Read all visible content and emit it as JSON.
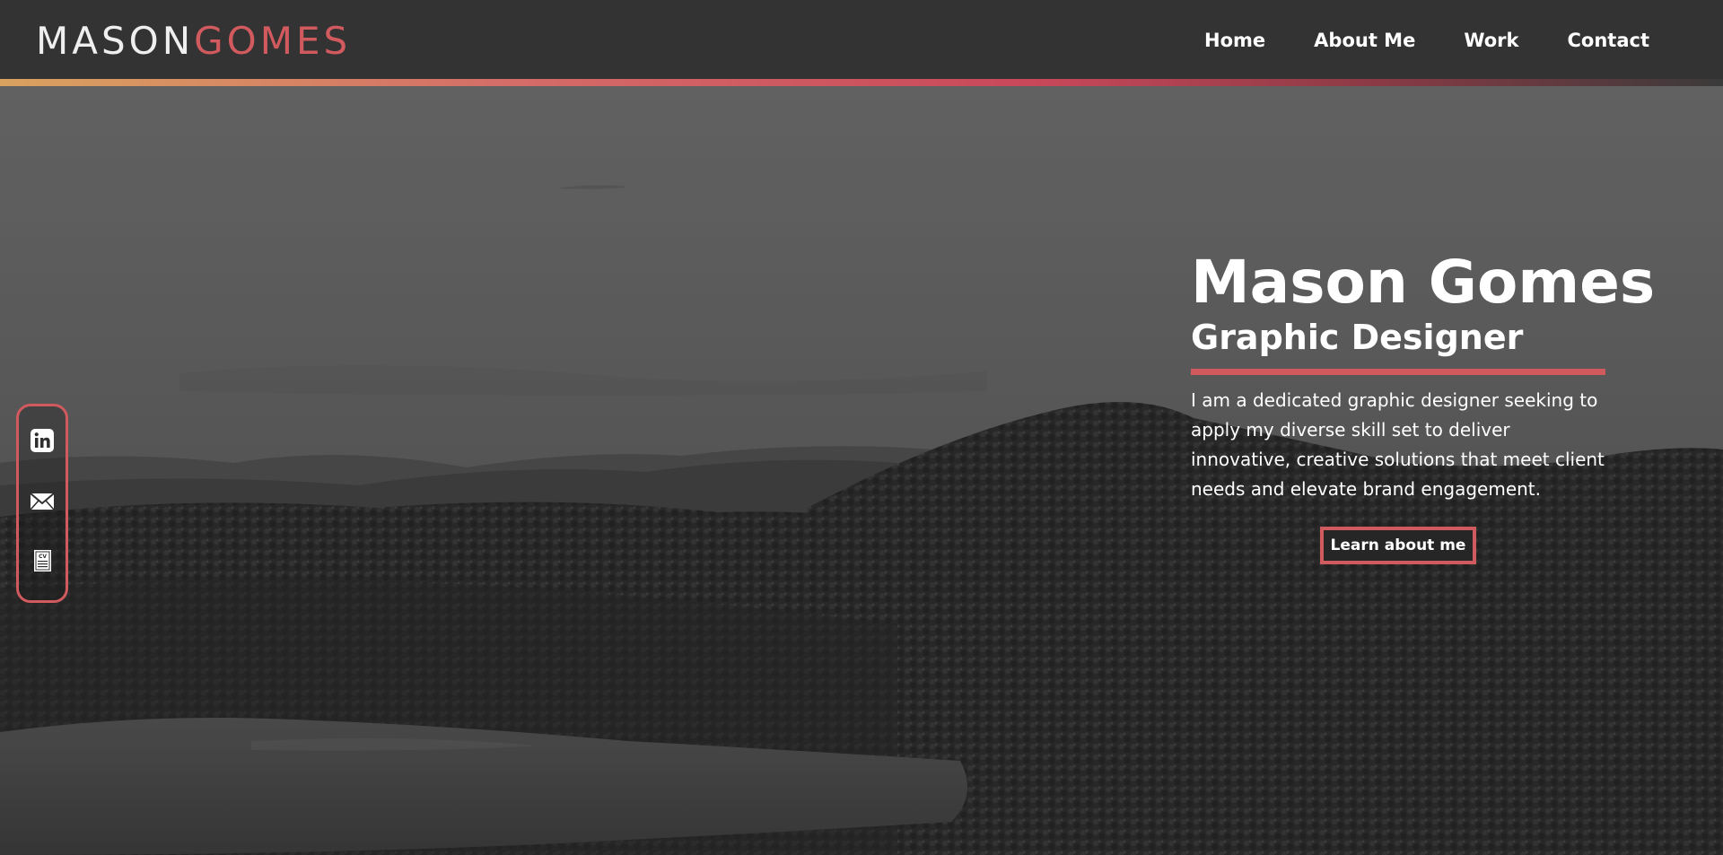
{
  "colors": {
    "accent": "#d05a5e",
    "header_bg": "#333333",
    "text": "#ffffff"
  },
  "logo": {
    "first": "MASON",
    "last": "GOMES"
  },
  "nav": {
    "items": [
      {
        "label": "Home"
      },
      {
        "label": "About Me"
      },
      {
        "label": "Work"
      },
      {
        "label": "Contact"
      }
    ]
  },
  "hero": {
    "name": "Mason Gomes",
    "role": "Graphic Designer",
    "description": "I am a dedicated graphic designer seeking to apply my diverse skill set to deliver innovative, creative solutions that meet client needs and elevate brand engagement.",
    "cta_label": "Learn about me"
  },
  "social": {
    "items": [
      {
        "icon": "linkedin-icon"
      },
      {
        "icon": "mail-icon"
      },
      {
        "icon": "cv-document-icon",
        "label": "CV"
      }
    ]
  }
}
